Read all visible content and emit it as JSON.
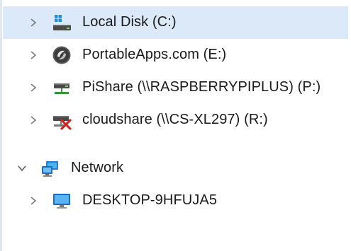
{
  "tree": {
    "items": [
      {
        "label": "Local Disk (C:)",
        "icon": "local-disk-icon",
        "expanded": false,
        "selected": true
      },
      {
        "label": "PortableApps.com (E:)",
        "icon": "portable-drive-icon",
        "expanded": false,
        "selected": false
      },
      {
        "label": "PiShare (\\\\RASPBERRYPIPLUS) (P:)",
        "icon": "network-drive-icon",
        "expanded": false,
        "selected": false
      },
      {
        "label": "cloudshare (\\\\CS-XL297) (R:)",
        "icon": "disconnected-network-drive-icon",
        "expanded": false,
        "selected": false
      },
      {
        "label": "Network",
        "icon": "network-icon",
        "expanded": true,
        "selected": false
      },
      {
        "label": "DESKTOP-9HFUJA5",
        "icon": "computer-icon",
        "expanded": false,
        "selected": false
      }
    ]
  },
  "colors": {
    "selection": "#dbe9f8",
    "chevron": "#7a7a7a",
    "text": "#1a1a1a"
  }
}
